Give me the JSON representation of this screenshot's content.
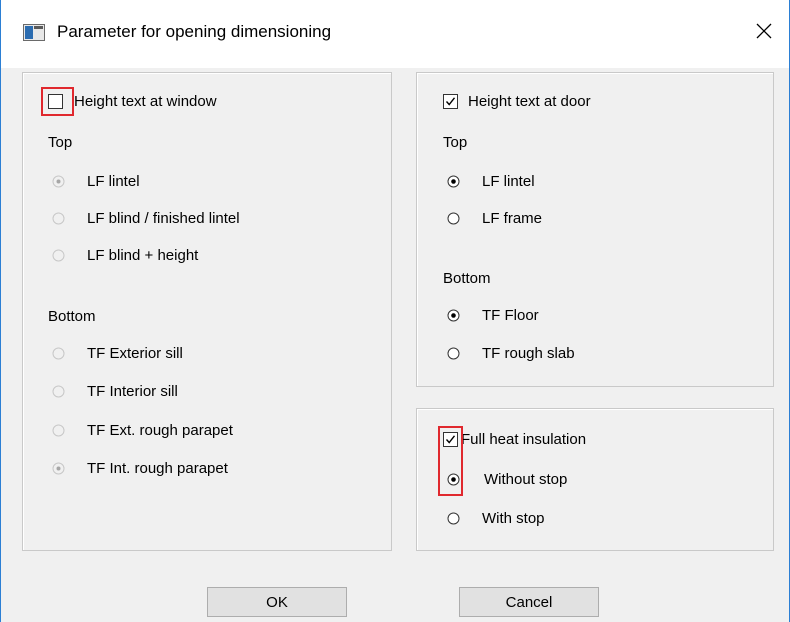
{
  "window": {
    "title": "Parameter for opening dimensioning"
  },
  "window_panel": {
    "checkbox_label": "Height text at window",
    "checked": false,
    "top_heading": "Top",
    "top_options": [
      "LF lintel",
      "LF blind / finished lintel",
      "LF blind + height"
    ],
    "top_selected": 0,
    "bottom_heading": "Bottom",
    "bottom_options": [
      "TF Exterior sill",
      "TF Interior sill",
      "TF Ext. rough parapet",
      "TF Int. rough parapet"
    ],
    "bottom_selected": 3,
    "enabled": false
  },
  "door_panel": {
    "checkbox_label": "Height text at door",
    "checked": true,
    "top_heading": "Top",
    "top_options": [
      "LF lintel",
      "LF frame"
    ],
    "top_selected": 0,
    "bottom_heading": "Bottom",
    "bottom_options": [
      "TF Floor",
      "TF rough slab"
    ],
    "bottom_selected": 0
  },
  "insulation_panel": {
    "checkbox_label": "Full heat insulation",
    "checked": true,
    "options": [
      "Without stop",
      "With stop"
    ],
    "selected": 0
  },
  "buttons": {
    "ok": "OK",
    "cancel": "Cancel"
  },
  "colors": {
    "highlight": "#e0282e",
    "dialog_background": "#f0f0f0",
    "window_border": "#2b7fd4"
  }
}
